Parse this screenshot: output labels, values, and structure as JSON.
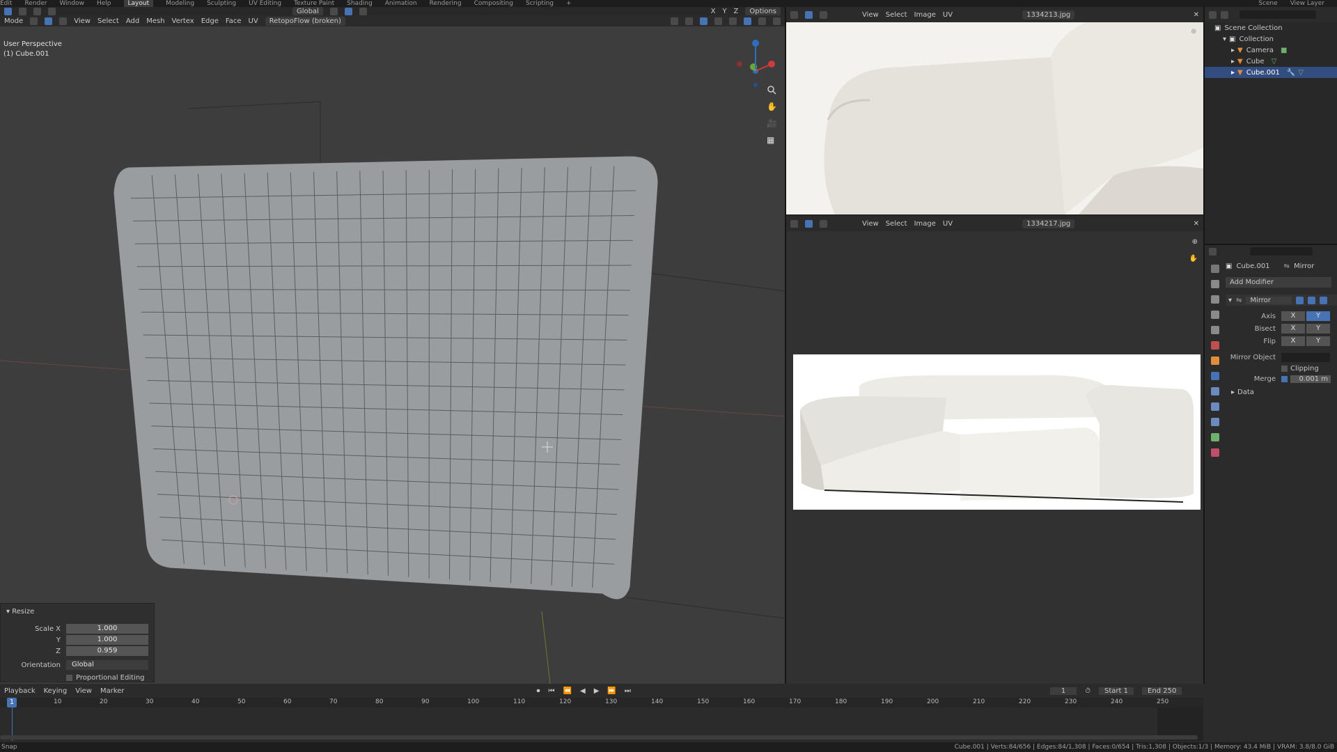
{
  "topbar": {
    "menus": [
      "Edit",
      "Render",
      "Window",
      "Help"
    ],
    "tabs": [
      "Layout",
      "Modeling",
      "Sculpting",
      "UV Editing",
      "Texture Paint",
      "Shading",
      "Animation",
      "Rendering",
      "Compositing",
      "Scripting",
      "+"
    ],
    "active_tab": "Layout",
    "scene": "Scene",
    "view_layer": "View Layer"
  },
  "viewport_header": {
    "mode": "Mode",
    "menus": [
      "View",
      "Select",
      "Add",
      "Mesh",
      "Vertex",
      "Edge",
      "Face",
      "UV"
    ],
    "addon": "RetopoFlow (broken)",
    "orientation": "Global",
    "options": "Options",
    "xyz": [
      "X",
      "Y",
      "Z"
    ]
  },
  "viewport": {
    "perspective": "User Perspective",
    "object": "(1) Cube.001"
  },
  "resize_panel": {
    "title": "Resize",
    "scale_x_label": "Scale X",
    "scale_x": "1.000",
    "y_label": "Y",
    "scale_y": "1.000",
    "z_label": "Z",
    "scale_z": "0.959",
    "orientation_label": "Orientation",
    "orientation": "Global",
    "proportional": "Proportional Editing"
  },
  "image_editor_top": {
    "menus": [
      "View",
      "Select",
      "Image",
      "UV"
    ],
    "filename": "1334213.jpg"
  },
  "image_editor_bottom": {
    "menus": [
      "View",
      "Select",
      "Image",
      "UV"
    ],
    "filename": "1334217.jpg"
  },
  "outliner": {
    "scene_collection": "Scene Collection",
    "items": [
      "Collection",
      "Camera",
      "Cube",
      "Cube.001"
    ]
  },
  "properties": {
    "object": "Cube.001",
    "modifier_tab": "Mirror",
    "add_modifier": "Add Modifier",
    "modifier_name": "Mirror",
    "axis_label": "Axis",
    "bisect_label": "Bisect",
    "flip_label": "Flip",
    "x": "X",
    "y": "Y",
    "mirror_object_label": "Mirror Object",
    "clipping": "Clipping",
    "merge_label": "Merge",
    "merge_value": "0.001 m",
    "data": "Data"
  },
  "timeline": {
    "menus": [
      "Playback",
      "Keying",
      "View",
      "Marker"
    ],
    "current_frame": "1",
    "start_label": "Start",
    "start": "1",
    "end_label": "End",
    "end": "250",
    "ticks": [
      "1",
      "10",
      "20",
      "30",
      "40",
      "50",
      "60",
      "70",
      "80",
      "90",
      "100",
      "110",
      "120",
      "130",
      "140",
      "150",
      "160",
      "170",
      "180",
      "190",
      "200",
      "210",
      "220",
      "230",
      "240",
      "250"
    ]
  },
  "status": {
    "left": "Snap",
    "right": "Cube.001 | Verts:84/656 | Edges:84/1,308 | Faces:0/654 | Tris:1,308 | Objects:1/3 | Memory: 43.4 MiB | VRAM: 3.8/8.0 GiB"
  },
  "colors": {
    "accent": "#4772b3",
    "viewport_bg": "#3d3d3d",
    "mesh": "#9a9d9f",
    "object_orange": "#e08d3c"
  }
}
